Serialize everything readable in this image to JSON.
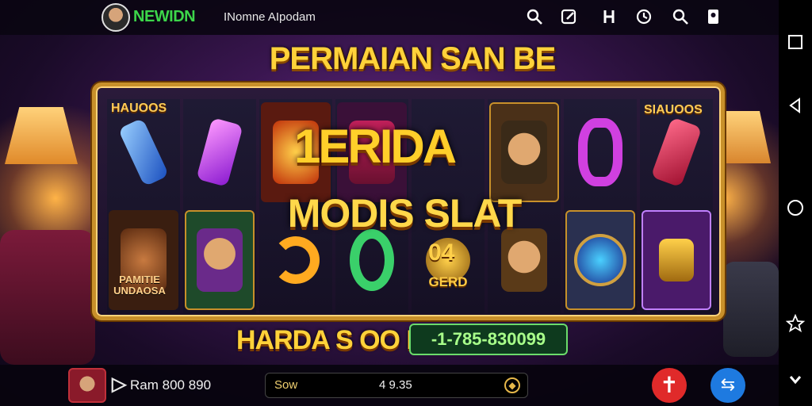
{
  "topbar": {
    "brand": "NEWIDN",
    "username": "INomne AIpodam",
    "icons": [
      "search-icon",
      "edit-icon",
      "user-icon",
      "history-icon",
      "search-icon",
      "profile-icon"
    ]
  },
  "banner": {
    "title": "PERMAIAN SAN BE"
  },
  "reels": {
    "left_label": "HAUOOS",
    "right_label": "SIAUOOS",
    "headline_1": "1ERIDA",
    "headline_2": "MODIS SLAT",
    "side_text": "PAMITIE UNDAOSA",
    "gerd_text": "GERD",
    "gerd_num": "04"
  },
  "win": {
    "label": "HARDA S OO K",
    "code": "-1-785-830099"
  },
  "bottombar": {
    "balance": "Ram 800 890",
    "bet_label": "Sow",
    "bet_value": "4 9.35"
  },
  "colors": {
    "accent_gold": "#ffd23a",
    "brand_green": "#3cd64a",
    "spin_red": "#e02a2a",
    "auto_blue": "#1e7ae0"
  }
}
